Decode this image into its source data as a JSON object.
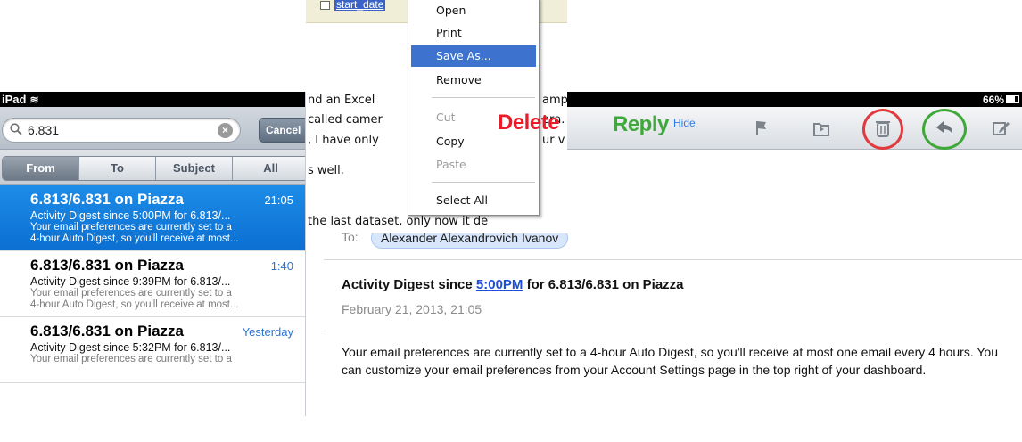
{
  "ipad_list": {
    "status_carrier": "iPad",
    "search": {
      "value": "6.831",
      "cancel_label": "Cancel"
    },
    "scope_tabs": [
      {
        "label": "From"
      },
      {
        "label": "To"
      },
      {
        "label": "Subject"
      },
      {
        "label": "All"
      }
    ],
    "messages": [
      {
        "from": "6.813/6.831 on Piazza",
        "time": "21:05",
        "subject": "Activity Digest since 5:00PM for 6.813/...",
        "preview1": "Your email preferences are currently set to a",
        "preview2": "4-hour Auto Digest, so you'll receive at most...",
        "selected": true
      },
      {
        "from": "6.813/6.831 on Piazza",
        "time": "1:40",
        "subject": "Activity Digest since 9:39PM for 6.813/...",
        "preview1": "Your email preferences are currently set to a",
        "preview2": "4-hour Auto Digest, so you'll receive at most..."
      },
      {
        "from": "6.813/6.831 on Piazza",
        "time": "Yesterday",
        "subject": "Activity Digest since 5:32PM for 6.813/...",
        "preview1": "Your email preferences are currently set to a",
        "preview2": ""
      }
    ]
  },
  "excel_doc": {
    "attachment_name": "start_date",
    "lines": [
      "nd an Excel",
      "called camer",
      ", I have only",
      "s well.",
      "the last dataset, only now it de"
    ],
    "line_fragments": [
      "amp",
      "era.",
      "ur v"
    ],
    "context_menu": {
      "items": [
        {
          "label": "Open"
        },
        {
          "label": "Print"
        },
        {
          "label": "Save As..."
        },
        {
          "label": "Remove"
        },
        {
          "label": "Cut"
        },
        {
          "label": "Copy"
        },
        {
          "label": "Paste"
        },
        {
          "label": "Select All"
        }
      ]
    }
  },
  "ipad_message": {
    "battery": "66%",
    "toolbar_icons": [
      "flag-icon",
      "folder-move-icon",
      "trash-icon",
      "reply-icon",
      "compose-icon"
    ],
    "annotations": {
      "delete": "Delete",
      "reply": "Reply"
    },
    "hide_label": "Hide",
    "to_label": "To:",
    "to_recipient": "Alexander Alexandrovich Ivanov",
    "subject_pre": "Activity Digest since ",
    "subject_link": "5:00PM",
    "subject_post": " for 6.813/6.831 on Piazza",
    "date": "February 21, 2013, 21:05",
    "body": "Your email preferences are currently set to a 4-hour Auto Digest, so you'll receive at most one email every 4 hours. You can customize your email preferences from your Account Settings page in the top right of your dashboard.",
    "colors": {
      "delete": "#ea1c2a",
      "reply": "#3fa83a",
      "selection": "#1d8ce8",
      "link": "#1c4fd6"
    }
  }
}
